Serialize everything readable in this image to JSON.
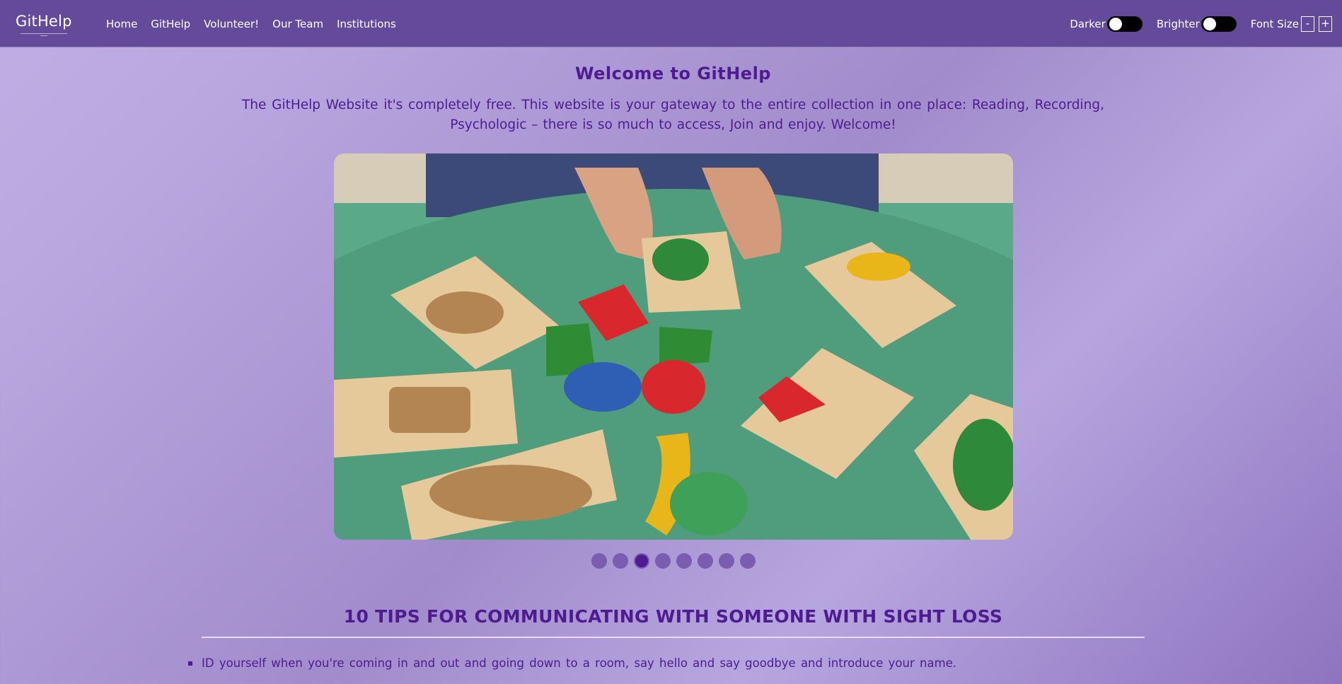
{
  "navbar": {
    "logo_text": "GitHelp",
    "links": [
      "Home",
      "GitHelp",
      "Volunteer!",
      "Our Team",
      "Institutions"
    ],
    "darker_label": "Darker",
    "brighter_label": "Brighter",
    "font_size_label": "Font Size",
    "font_decrease": "-",
    "font_increase": "+"
  },
  "main": {
    "title": "Welcome to GitHelp",
    "intro": "The GitHelp Website it's completely free. This website is your gateway to the entire collection in one place: Reading, Recording, Psychologic – there is so much to access, Join and enjoy. Welcome!",
    "carousel": {
      "slide_count": 8,
      "active_index": 2
    }
  },
  "tips": {
    "title": "10 TIPS FOR COMMUNICATING WITH SOMEONE WITH SIGHT LOSS",
    "items": [
      "ID yourself when you're coming in and out and going down to a room, say hello and say goodbye and introduce your name."
    ]
  },
  "colors": {
    "navbar_bg": "#654a9b",
    "accent_text": "#4e1b90",
    "dot": "#7c5cb0"
  }
}
